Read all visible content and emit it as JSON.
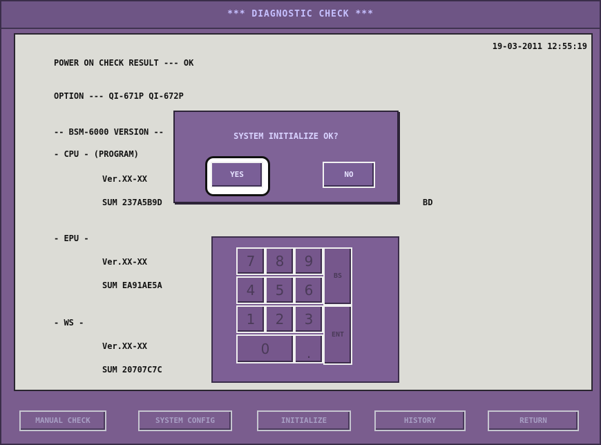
{
  "window": {
    "title": "*** DIAGNOSTIC CHECK ***"
  },
  "screen": {
    "timestamp": "19-03-2011 12:55:19",
    "lines": {
      "power_check": "POWER ON CHECK RESULT --- OK",
      "option": "OPTION --- QI-671P QI-672P",
      "bsm_version": "-- BSM-6000 VERSION --",
      "cpu_header": "- CPU - (PROGRAM)",
      "cpu_ver": "Ver.XX-XX",
      "cpu_sum": "SUM 237A5B9D",
      "cpu_sum_right": "BD",
      "epu_header": "- EPU -",
      "epu_ver": "Ver.XX-XX",
      "epu_sum": "SUM EA91AE5A",
      "ws_header": "- WS -",
      "ws_ver": "Ver.XX-XX",
      "ws_sum": "SUM 20707C7C"
    }
  },
  "dialog": {
    "message": "SYSTEM INITIALIZE OK?",
    "yes_label": "YES",
    "no_label": "NO"
  },
  "keypad": {
    "k7": "7",
    "k8": "8",
    "k9": "9",
    "k4": "4",
    "k5": "5",
    "k6": "6",
    "k1": "1",
    "k2": "2",
    "k3": "3",
    "k0": "0",
    "kdot": ".",
    "bs": "BS",
    "ent": "ENT"
  },
  "bottom_menu": {
    "manual_check": "MANUAL CHECK",
    "system_config": "SYSTEM CONFIG",
    "initialize": "INITIALIZE",
    "history": "HISTORY",
    "return": "RETURN"
  },
  "colors": {
    "frame": "#7a5d8e",
    "panel": "#dcdcd6",
    "title_text": "#c6c0ff"
  }
}
